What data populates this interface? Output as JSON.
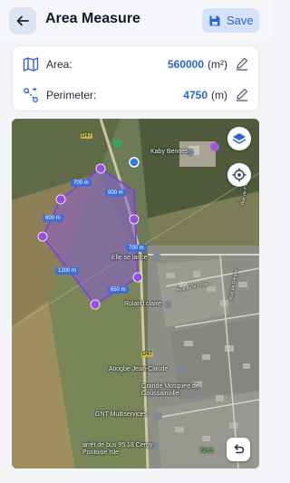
{
  "header": {
    "title": "Area Measure",
    "save_label": "Save",
    "back_icon": "arrow-left-icon",
    "save_icon": "floppy-disk-icon"
  },
  "measurements": {
    "area": {
      "label": "Area:",
      "value": "560000",
      "unit": "(m²)",
      "icon": "map-icon"
    },
    "perimeter": {
      "label": "Perimeter:",
      "value": "4750",
      "unit": "(m)",
      "icon": "route-icon"
    }
  },
  "map": {
    "place_labels": {
      "kaby_bennes": "Kaby Bennes",
      "elle_se_lance": "Elle se lance",
      "roland_claire": "Roland claire",
      "rue_de_la_poste": "Rue de la Poste",
      "atiogbe": "Atiogbe Jean-Claude",
      "grande_moschee": "Grande Mosquée de Goussainville",
      "gnt": "GNT Multiservices",
      "arret_bus": "arrêt de bus 95.18 Cergy Pontoise Isle",
      "road_d47_top": "D47",
      "road_d47_mid": "D47",
      "rue_de_garges": "Rue de Garges",
      "rue_de_paris": "Rue de Paris",
      "netslap": "Nets"
    },
    "segments": {
      "s1": "700 m",
      "s2": "900 m",
      "s3": "600 m",
      "s4": "700 m",
      "s5": "1200 m",
      "s6": "650 m"
    },
    "controls": {
      "layers_icon": "layers-icon",
      "locate_icon": "crosshair-icon",
      "undo_icon": "undo-icon"
    }
  },
  "colors": {
    "accent": "#2d63d0",
    "polygon_fill": "#8a5cd6",
    "vertex": "#9b4fe0"
  }
}
